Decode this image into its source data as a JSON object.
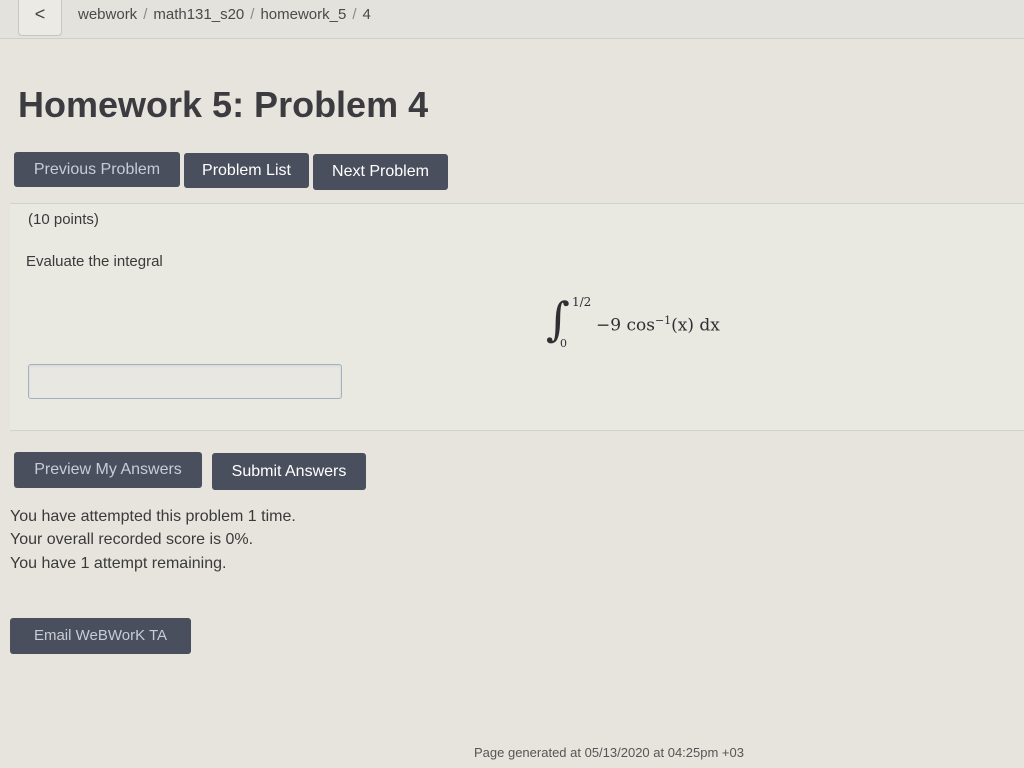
{
  "topbar": {
    "back_label": "<",
    "breadcrumb": [
      "webwork",
      "math131_s20",
      "homework_5",
      "4"
    ],
    "separator": "/"
  },
  "page": {
    "title": "Homework 5: Problem 4"
  },
  "nav": {
    "previous_label": "Previous Problem",
    "list_label": "Problem List",
    "next_label": "Next Problem"
  },
  "problem": {
    "points": "(10 points)",
    "instruction": "Evaluate the integral",
    "integral": {
      "lower": "0",
      "upper": "1/2",
      "integrand_coef": "−9 cos",
      "integrand_sup": "−1",
      "integrand_rest": "(x) dx"
    },
    "answer_value": "",
    "answer_placeholder": ""
  },
  "actions": {
    "preview_label": "Preview My Answers",
    "submit_label": "Submit Answers"
  },
  "status": {
    "attempts": "You have attempted this problem 1 time.",
    "score": "Your overall recorded score is 0%.",
    "remaining": "You have 1 attempt remaining."
  },
  "email": {
    "label": "Email WeBWorK TA"
  },
  "footer": {
    "text": "Page generated at 05/13/2020 at 04:25pm +03"
  },
  "colors": {
    "button_bg": "#4a4f5e",
    "page_bg": "#e6e4dc",
    "input_border": "#9fb3c4"
  }
}
